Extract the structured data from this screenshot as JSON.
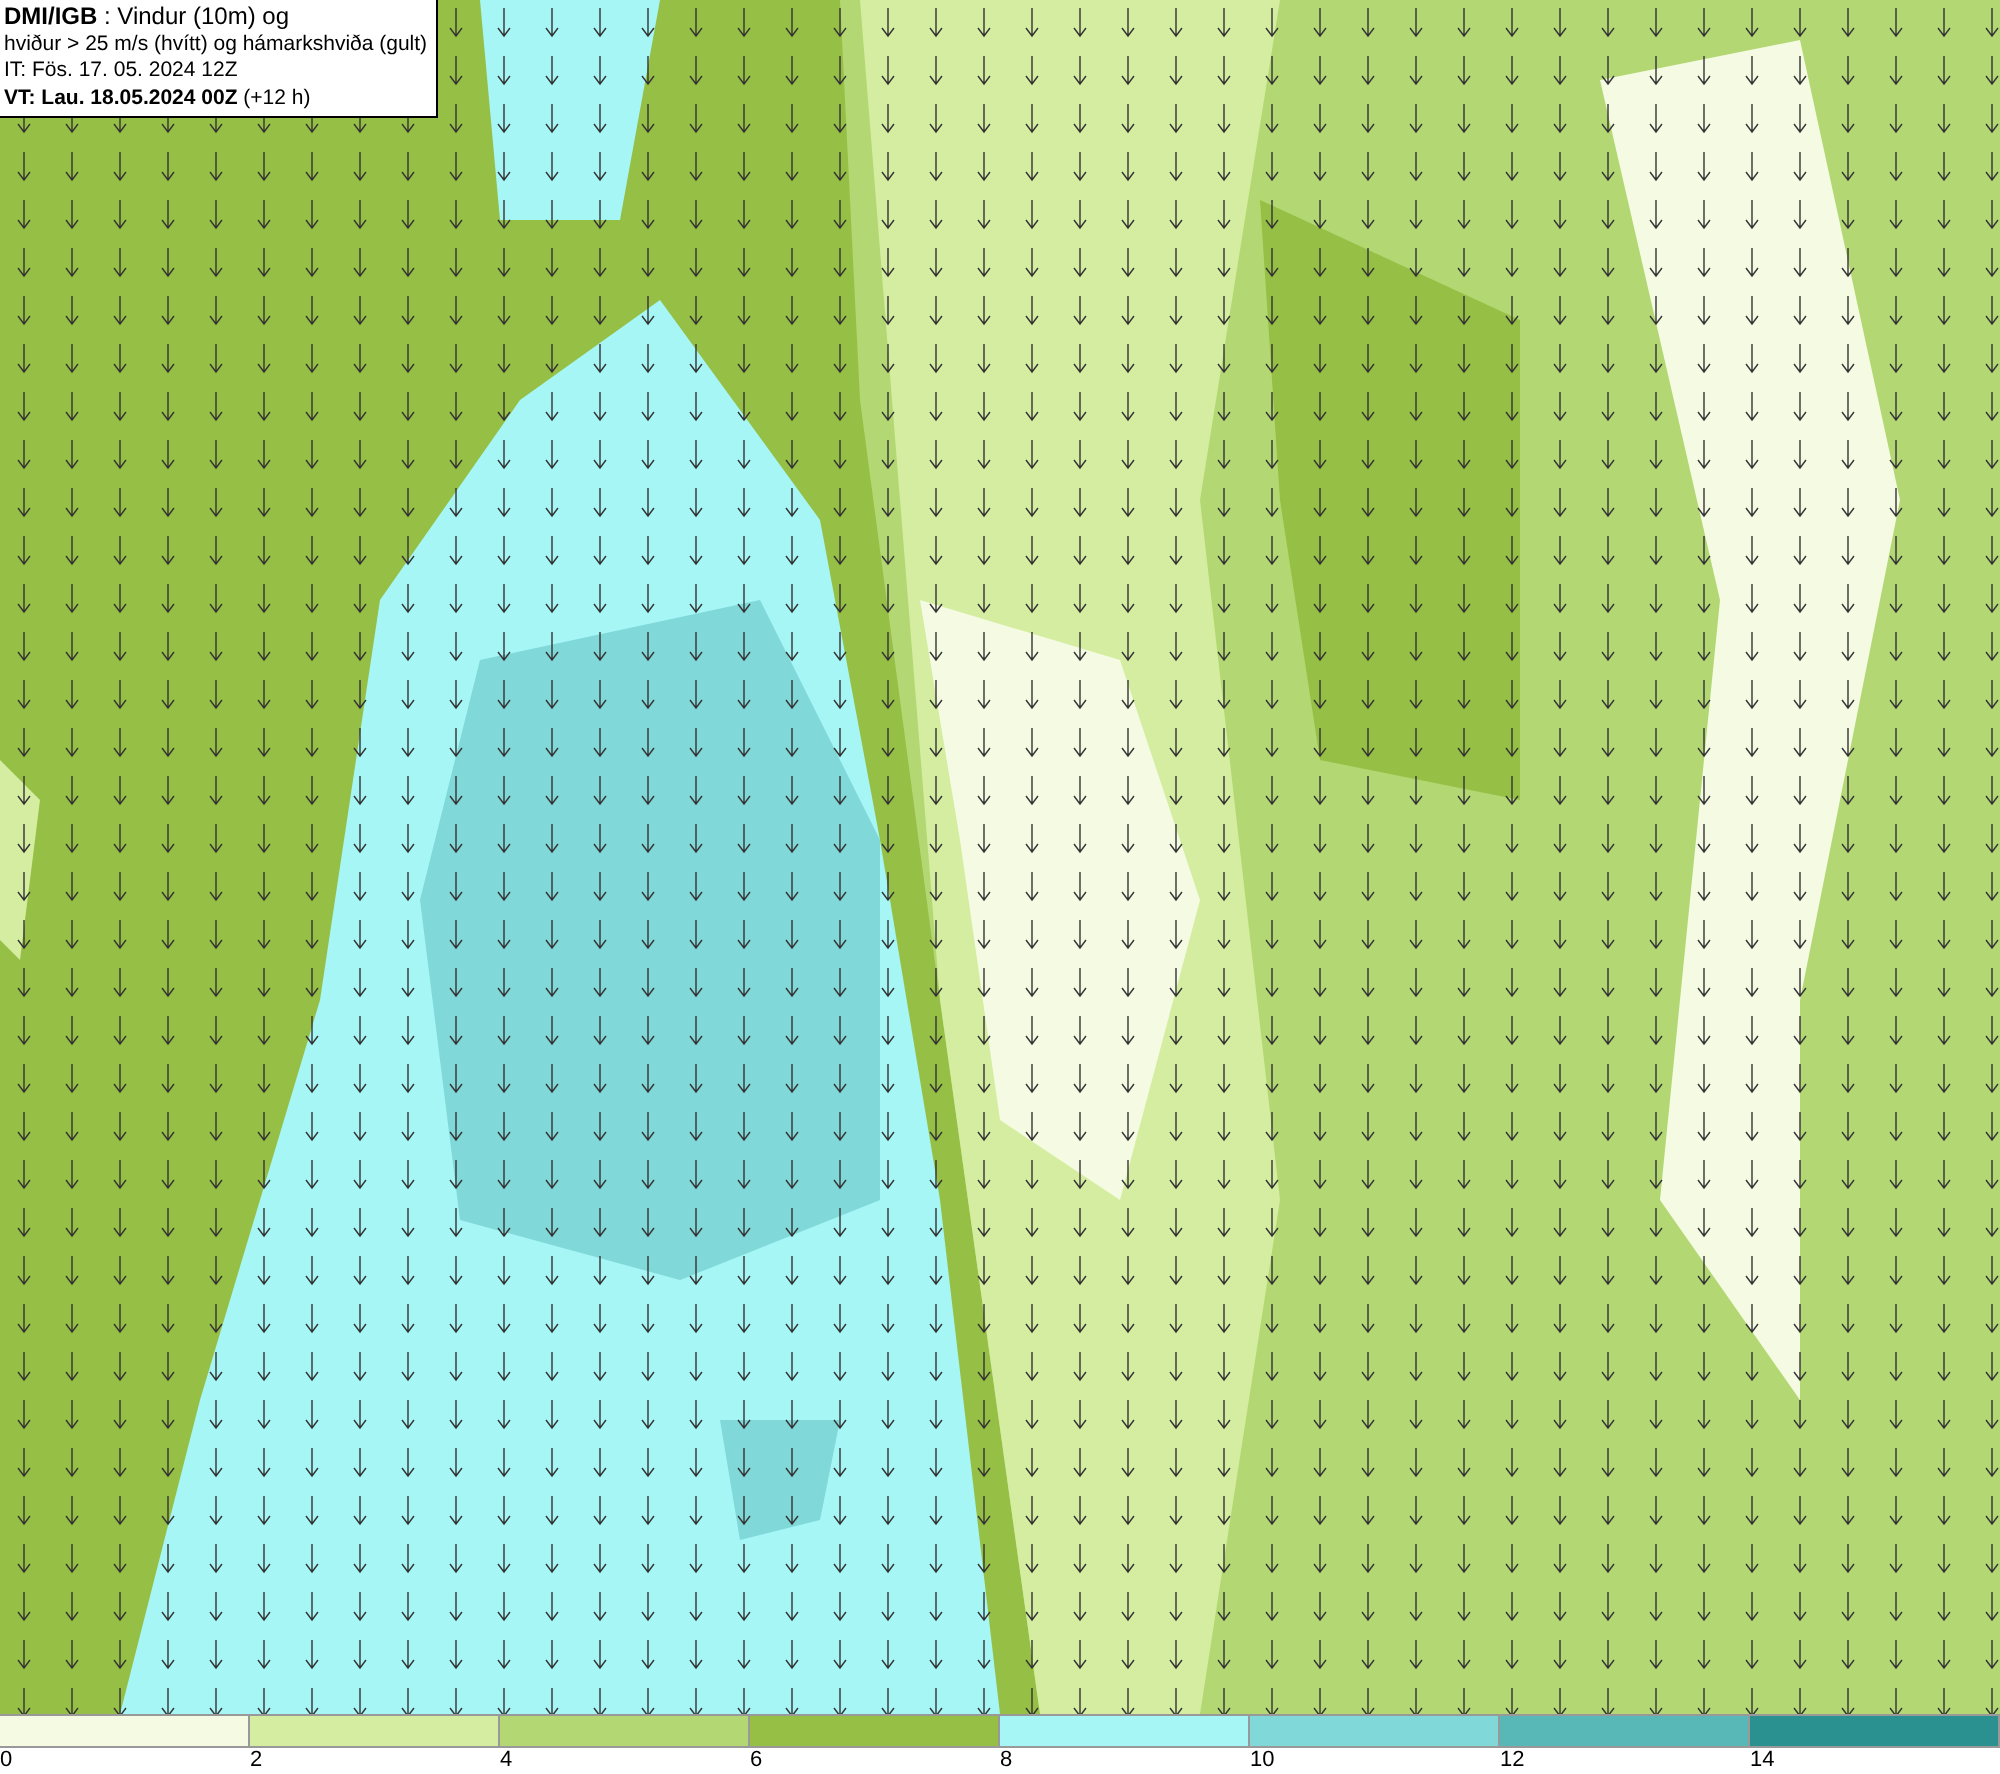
{
  "title_box": {
    "lines": [
      "**DMI/IGB** : Vindur (10m) og",
      "hviður > 25 m/s (hvítt) og hámarkshviða (gult)",
      "IT: Fös. 17. 05. 2024 12Z",
      "**VT: Lau. 18.05.2024 00Z** (+12 h)"
    ]
  },
  "legend": [
    {
      "label": "0",
      "color": "#f5fbe3"
    },
    {
      "label": "2",
      "color": "#d4eda0"
    },
    {
      "label": "4",
      "color": "#b3d873"
    },
    {
      "label": "6",
      "color": "#96bf45"
    },
    {
      "label": "8",
      "color": "#a6f6f6"
    },
    {
      "label": "10",
      "color": "#80d8d8"
    },
    {
      "label": "12",
      "color": "#58b8b8"
    },
    {
      "label": "14",
      "color": "#2a9090"
    }
  ]
}
